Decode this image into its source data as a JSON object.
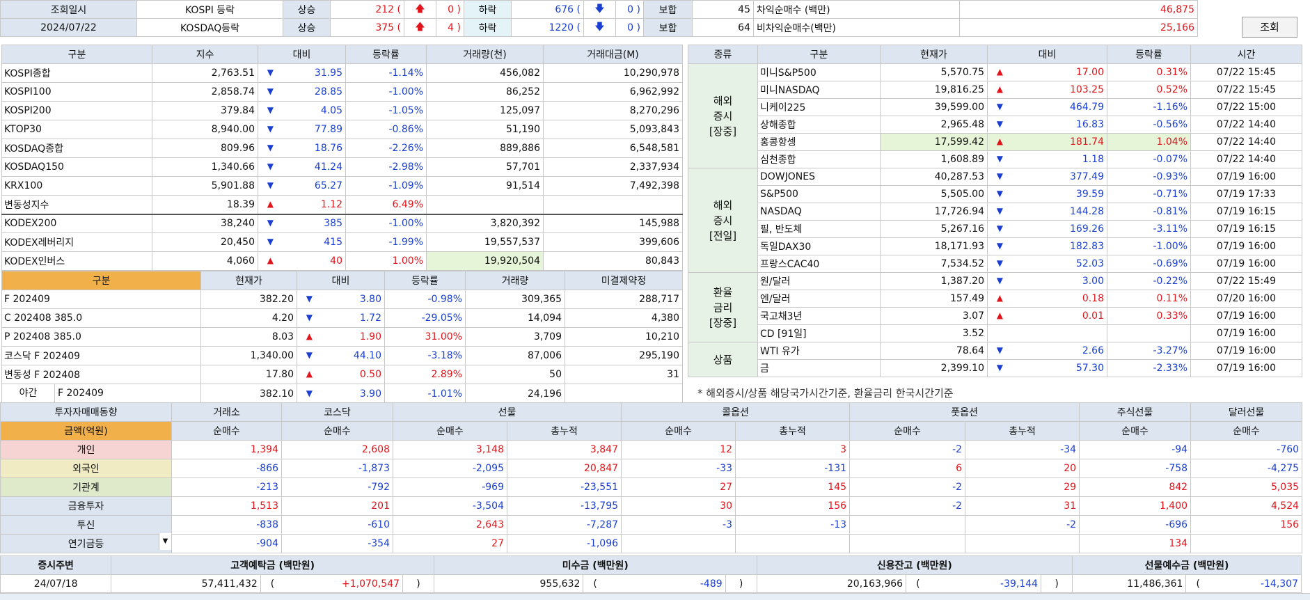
{
  "top": {
    "label1": "조회일시",
    "date": "2024/07/22",
    "rows": [
      {
        "name": "KOSPI 등락",
        "up_label": "상승",
        "up": "212 (",
        "up_bracket": "0 )",
        "down_label": "하락",
        "down": "676 (",
        "down_bracket": "0 )",
        "hold_label": "보합",
        "hold": "45"
      },
      {
        "name": "KOSDAQ등락",
        "up_label": "상승",
        "up": "375 (",
        "up_bracket": "4 )",
        "down_label": "하락",
        "down": "1220 (",
        "down_bracket": "0 )",
        "hold_label": "보합",
        "hold": "64"
      }
    ],
    "arb": [
      {
        "label": "차익순매수  (백만)",
        "value": "46,875"
      },
      {
        "label": "비차익순매수(백만)",
        "value": "25,166"
      }
    ],
    "query_button": "조회"
  },
  "index_table": {
    "headers": [
      "구분",
      "지수",
      "대비",
      "등락률",
      "거래량(천)",
      "거래대금(M)"
    ],
    "rows": [
      {
        "name": "KOSPI종합",
        "val": "2,763.51",
        "dir": "down",
        "chg": "31.95",
        "pct": "-1.14%",
        "vol": "456,082",
        "amt": "10,290,978"
      },
      {
        "name": "KOSPI100",
        "val": "2,858.74",
        "dir": "down",
        "chg": "28.85",
        "pct": "-1.00%",
        "vol": "86,252",
        "amt": "6,962,992"
      },
      {
        "name": "KOSPI200",
        "val": "379.84",
        "dir": "down",
        "chg": "4.05",
        "pct": "-1.05%",
        "vol": "125,097",
        "amt": "8,270,296"
      },
      {
        "name": "KTOP30",
        "val": "8,940.00",
        "dir": "down",
        "chg": "77.89",
        "pct": "-0.86%",
        "vol": "51,190",
        "amt": "5,093,843"
      },
      {
        "name": "KOSDAQ종합",
        "val": "809.96",
        "dir": "down",
        "chg": "18.76",
        "pct": "-2.26%",
        "vol": "889,886",
        "amt": "6,548,581"
      },
      {
        "name": "KOSDAQ150",
        "val": "1,340.66",
        "dir": "down",
        "chg": "41.24",
        "pct": "-2.98%",
        "vol": "57,701",
        "amt": "2,337,934"
      },
      {
        "name": "KRX100",
        "val": "5,901.88",
        "dir": "down",
        "chg": "65.27",
        "pct": "-1.09%",
        "vol": "91,514",
        "amt": "7,492,398"
      },
      {
        "name": "변동성지수",
        "val": "18.39",
        "dir": "up",
        "chg": "1.12",
        "pct": "6.49%",
        "vol": "",
        "amt": ""
      },
      {
        "name": "KODEX200",
        "val": "38,240",
        "dir": "down",
        "chg": "385",
        "pct": "-1.00%",
        "vol": "3,820,392",
        "amt": "145,988"
      },
      {
        "name": "KODEX레버리지",
        "val": "20,450",
        "dir": "down",
        "chg": "415",
        "pct": "-1.99%",
        "vol": "19,557,537",
        "amt": "399,606"
      },
      {
        "name": "KODEX인버스",
        "val": "4,060",
        "dir": "up",
        "chg": "40",
        "pct": "1.00%",
        "vol": "19,920,504",
        "amt": "80,843"
      }
    ]
  },
  "futures_table": {
    "headers": [
      "구분",
      "현재가",
      "대비",
      "등락률",
      "거래량",
      "미결제약정"
    ],
    "rows": [
      {
        "name": "F 202409",
        "val": "382.20",
        "dir": "down",
        "chg": "3.80",
        "pct": "-0.98%",
        "vol": "309,365",
        "oi": "288,717"
      },
      {
        "name": "C 202408 385.0",
        "val": "4.20",
        "dir": "down",
        "chg": "1.72",
        "pct": "-29.05%",
        "vol": "14,094",
        "oi": "4,380"
      },
      {
        "name": "P 202408 385.0",
        "val": "8.03",
        "dir": "up",
        "chg": "1.90",
        "pct": "31.00%",
        "vol": "3,709",
        "oi": "10,210"
      },
      {
        "name": "코스닥 F 202409",
        "val": "1,340.00",
        "dir": "down",
        "chg": "44.10",
        "pct": "-3.18%",
        "vol": "87,006",
        "oi": "295,190"
      },
      {
        "name": "변동성 F 202408",
        "val": "17.80",
        "dir": "up",
        "chg": "0.50",
        "pct": "2.89%",
        "vol": "50",
        "oi": "31"
      }
    ],
    "night": {
      "label": "야간",
      "name": "F 202409",
      "val": "382.10",
      "dir": "down",
      "chg": "3.90",
      "pct": "-1.01%",
      "vol": "24,196",
      "oi": ""
    }
  },
  "world_table": {
    "headers": [
      "종류",
      "구분",
      "현재가",
      "대비",
      "등락률",
      "시간"
    ],
    "groups": [
      {
        "label": "해외\n증시\n[장중]",
        "rows": [
          {
            "name": "미니S&P500",
            "val": "5,570.75",
            "dir": "up",
            "chg": "17.00",
            "pct": "0.31%",
            "time": "07/22 15:45"
          },
          {
            "name": "미니NASDAQ",
            "val": "19,816.25",
            "dir": "up",
            "chg": "103.25",
            "pct": "0.52%",
            "time": "07/22 15:45"
          },
          {
            "name": "니케이225",
            "val": "39,599.00",
            "dir": "down",
            "chg": "464.79",
            "pct": "-1.16%",
            "time": "07/22 15:00"
          },
          {
            "name": "상해종합",
            "val": "2,965.48",
            "dir": "down",
            "chg": "16.83",
            "pct": "-0.56%",
            "time": "07/22 14:40"
          },
          {
            "name": "홍콩항셍",
            "val": "17,599.42",
            "dir": "up",
            "chg": "181.74",
            "pct": "1.04%",
            "time": "07/22 14:40"
          },
          {
            "name": "심천종합",
            "val": "1,608.89",
            "dir": "down",
            "chg": "1.18",
            "pct": "-0.07%",
            "time": "07/22 14:40"
          }
        ]
      },
      {
        "label": "해외\n증시\n[전일]",
        "rows": [
          {
            "name": "DOWJONES",
            "val": "40,287.53",
            "dir": "down",
            "chg": "377.49",
            "pct": "-0.93%",
            "time": "07/19 16:00"
          },
          {
            "name": "S&P500",
            "val": "5,505.00",
            "dir": "down",
            "chg": "39.59",
            "pct": "-0.71%",
            "time": "07/19 17:33"
          },
          {
            "name": "NASDAQ",
            "val": "17,726.94",
            "dir": "down",
            "chg": "144.28",
            "pct": "-0.81%",
            "time": "07/19 16:15"
          },
          {
            "name": "필, 반도체",
            "val": "5,267.16",
            "dir": "down",
            "chg": "169.26",
            "pct": "-3.11%",
            "time": "07/19 16:15"
          },
          {
            "name": "독일DAX30",
            "val": "18,171.93",
            "dir": "down",
            "chg": "182.83",
            "pct": "-1.00%",
            "time": "07/19 16:00"
          },
          {
            "name": "프랑스CAC40",
            "val": "7,534.52",
            "dir": "down",
            "chg": "52.03",
            "pct": "-0.69%",
            "time": "07/19 16:00"
          }
        ]
      },
      {
        "label": "환율\n금리\n[장중]",
        "rows": [
          {
            "name": "원/달러",
            "val": "1,387.20",
            "dir": "down",
            "chg": "3.00",
            "pct": "-0.22%",
            "time": "07/22 15:49"
          },
          {
            "name": "엔/달러",
            "val": "157.49",
            "dir": "up",
            "chg": "0.18",
            "pct": "0.11%",
            "time": "07/20 16:00"
          },
          {
            "name": "국고채3년",
            "val": "3.07",
            "dir": "up",
            "chg": "0.01",
            "pct": "0.33%",
            "time": "07/19 16:00"
          },
          {
            "name": "CD [91일]",
            "val": "3.52",
            "dir": "",
            "chg": "",
            "pct": "",
            "time": "07/19 16:00"
          }
        ]
      },
      {
        "label": "상품",
        "rows": [
          {
            "name": "WTI 유가",
            "val": "78.64",
            "dir": "down",
            "chg": "2.66",
            "pct": "-3.27%",
            "time": "07/19 16:00"
          },
          {
            "name": "금",
            "val": "2,399.10",
            "dir": "down",
            "chg": "57.30",
            "pct": "-2.33%",
            "time": "07/19 16:00"
          }
        ]
      }
    ],
    "note": "* 해외증시/상품 해당국가시간기준, 환율금리 한국시간기준"
  },
  "investor_table": {
    "title": "투자자매매동향",
    "unit": "금액(억원)",
    "groups": [
      "거래소",
      "코스닥",
      "선물",
      "콜옵션",
      "풋옵션",
      "주식선물",
      "달러선물"
    ],
    "sub": [
      "순매수",
      "순매수",
      "순매수",
      "총누적",
      "순매수",
      "총누적",
      "순매수",
      "총누적",
      "순매수",
      "순매수"
    ],
    "rows": [
      {
        "name": "개인",
        "vals": [
          "1,394",
          "2,608",
          "3,148",
          "3,847",
          "12",
          "3",
          "-2",
          "-34",
          "-94",
          "-760"
        ]
      },
      {
        "name": "외국인",
        "vals": [
          "-866",
          "-1,873",
          "-2,095",
          "20,847",
          "-33",
          "-131",
          "6",
          "20",
          "-758",
          "-4,275"
        ]
      },
      {
        "name": "기관계",
        "vals": [
          "-213",
          "-792",
          "-969",
          "-23,551",
          "27",
          "145",
          "-2",
          "29",
          "842",
          "5,035"
        ]
      },
      {
        "name": "금융투자",
        "vals": [
          "1,513",
          "201",
          "-3,504",
          "-13,795",
          "30",
          "156",
          "-2",
          "31",
          "1,400",
          "4,524"
        ]
      },
      {
        "name": "투신",
        "vals": [
          "-838",
          "-610",
          "2,643",
          "-7,287",
          "-3",
          "-13",
          "",
          "-2",
          "-696",
          "156"
        ]
      },
      {
        "name": "연기금등",
        "vals": [
          "-904",
          "-354",
          "27",
          "-1,096",
          "",
          "",
          "",
          "",
          "134",
          ""
        ]
      }
    ],
    "dropdown_icon": "▼"
  },
  "deposit_table": {
    "headers": [
      "증시주변",
      "고객예탁금 (백만원)",
      "미수금 (백만원)",
      "신용잔고 (백만원)",
      "선물예수금 (백만원)"
    ],
    "date": "24/07/18",
    "items": [
      {
        "val": "57,411,432",
        "chg": "+1,070,547"
      },
      {
        "val": "955,632",
        "chg": "-489"
      },
      {
        "val": "20,163,966",
        "chg": "-39,144"
      },
      {
        "val": "11,486,361",
        "chg": "-14,307"
      }
    ]
  },
  "colors": {
    "header": "#dde6f0",
    "orange": "#f2b04a",
    "up": "#e0141a",
    "down": "#1a3fd0"
  }
}
